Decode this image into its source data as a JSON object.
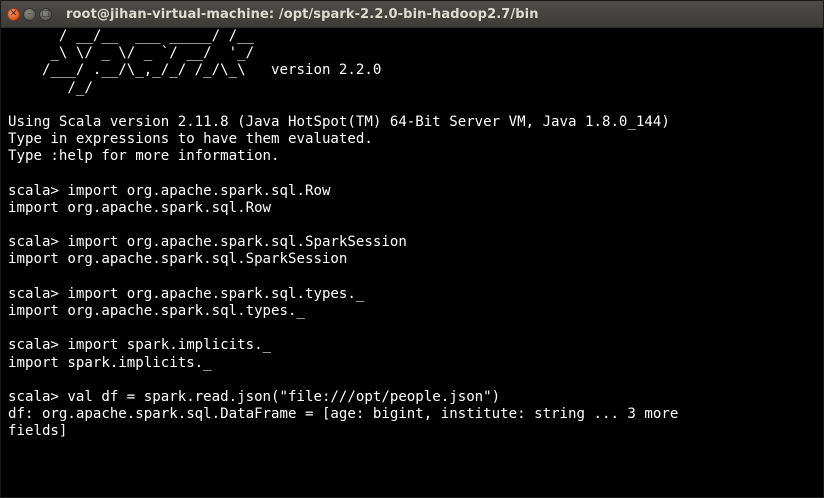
{
  "window": {
    "title": "root@jihan-virtual-machine: /opt/spark-2.2.0-bin-hadoop2.7/bin",
    "close_glyph": "✕",
    "minimize_glyph": "–",
    "maximize_glyph": "□"
  },
  "terminal": {
    "lines": [
      "      / __/__  ___ _____/ /__",
      "     _\\ \\/ _ \\/ _ `/ __/  '_/",
      "    /___/ .__/\\_,_/_/ /_/\\_\\   version 2.2.0",
      "       /_/",
      "",
      "Using Scala version 2.11.8 (Java HotSpot(TM) 64-Bit Server VM, Java 1.8.0_144)",
      "Type in expressions to have them evaluated.",
      "Type :help for more information.",
      "",
      "scala> import org.apache.spark.sql.Row",
      "import org.apache.spark.sql.Row",
      "",
      "scala> import org.apache.spark.sql.SparkSession",
      "import org.apache.spark.sql.SparkSession",
      "",
      "scala> import org.apache.spark.sql.types._",
      "import org.apache.spark.sql.types._",
      "",
      "scala> import spark.implicits._",
      "import spark.implicits._",
      "",
      "scala> val df = spark.read.json(\"file:///opt/people.json\")",
      "df: org.apache.spark.sql.DataFrame = [age: bigint, institute: string ... 3 more",
      "fields]"
    ]
  },
  "colors": {
    "terminal_background": "#000000",
    "terminal_text": "#ffffff",
    "titlebar": "#3c3b37",
    "close_button": "#e0591f"
  }
}
